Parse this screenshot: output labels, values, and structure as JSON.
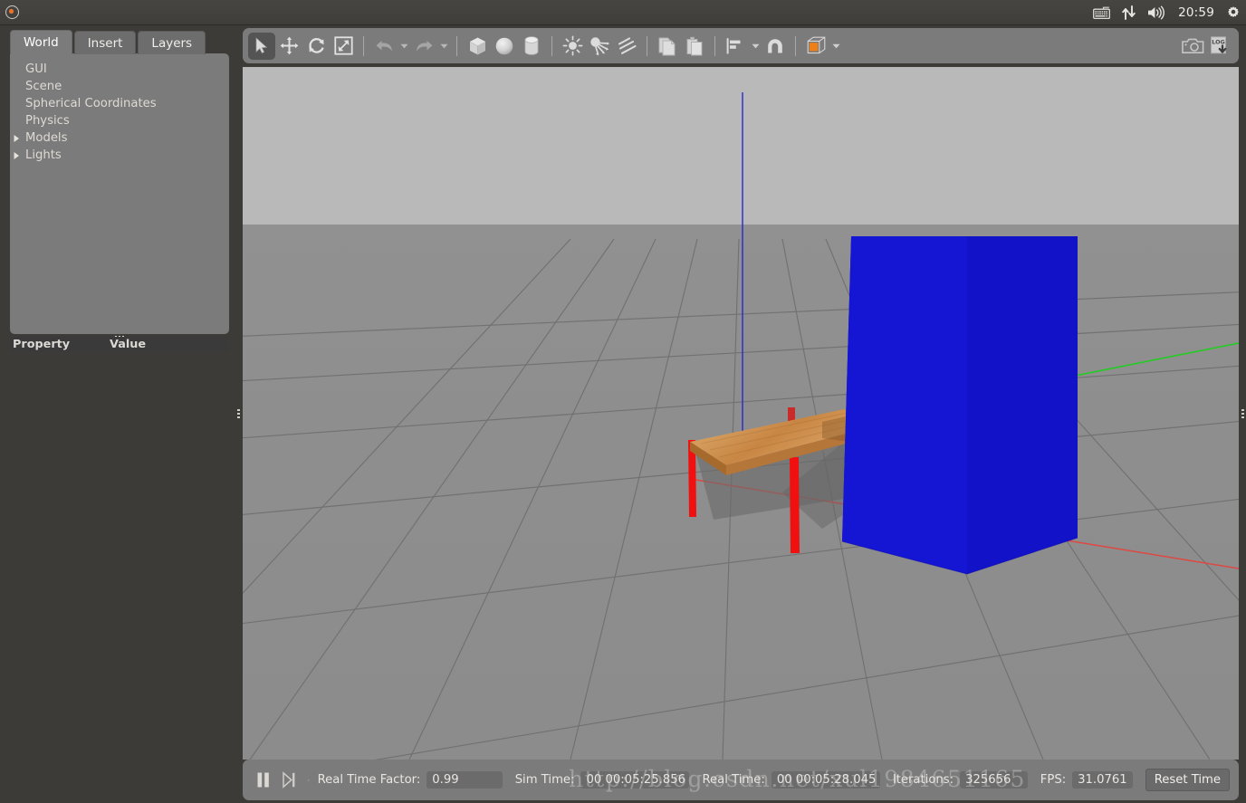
{
  "system_panel": {
    "logo_icon": "ubuntu-logo-icon",
    "tray": [
      {
        "name": "keyboard-icon",
        "label": ""
      },
      {
        "name": "network-icon",
        "label": ""
      },
      {
        "name": "volume-icon",
        "label": ""
      }
    ],
    "clock": "20:59",
    "settings_icon": "gear-icon"
  },
  "left_panel": {
    "tabs": [
      {
        "id": "world",
        "label": "World",
        "active": true
      },
      {
        "id": "insert",
        "label": "Insert",
        "active": false
      },
      {
        "id": "layers",
        "label": "Layers",
        "active": false
      }
    ],
    "tree": [
      {
        "label": "GUI",
        "expandable": false
      },
      {
        "label": "Scene",
        "expandable": false
      },
      {
        "label": "Spherical Coordinates",
        "expandable": false
      },
      {
        "label": "Physics",
        "expandable": false
      },
      {
        "label": "Models",
        "expandable": true
      },
      {
        "label": "Lights",
        "expandable": true
      }
    ],
    "property_table": {
      "headers": [
        "Property",
        "Value"
      ],
      "rows": []
    }
  },
  "toolbar": {
    "groups": [
      {
        "buttons": [
          {
            "name": "select-mode-button",
            "icon": "arrow-cursor-icon",
            "selected": true,
            "disabled": false
          },
          {
            "name": "translate-mode-button",
            "icon": "move-arrows-icon",
            "selected": false,
            "disabled": false
          },
          {
            "name": "rotate-mode-button",
            "icon": "rotate-icon",
            "selected": false,
            "disabled": false
          },
          {
            "name": "scale-mode-button",
            "icon": "scale-icon",
            "selected": false,
            "disabled": false
          }
        ]
      },
      {
        "buttons": [
          {
            "name": "undo-button",
            "icon": "undo-arrow-icon",
            "selected": false,
            "disabled": true,
            "caret": true
          },
          {
            "name": "redo-button",
            "icon": "redo-arrow-icon",
            "selected": false,
            "disabled": true,
            "caret": true
          }
        ]
      },
      {
        "buttons": [
          {
            "name": "insert-box-button",
            "icon": "box-icon",
            "selected": false,
            "disabled": false
          },
          {
            "name": "insert-sphere-button",
            "icon": "sphere-icon",
            "selected": false,
            "disabled": false
          },
          {
            "name": "insert-cylinder-button",
            "icon": "cylinder-icon",
            "selected": false,
            "disabled": false
          }
        ]
      },
      {
        "buttons": [
          {
            "name": "point-light-button",
            "icon": "point-light-icon",
            "selected": false,
            "disabled": false
          },
          {
            "name": "spot-light-button",
            "icon": "spot-light-icon",
            "selected": false,
            "disabled": false
          },
          {
            "name": "directional-light-button",
            "icon": "directional-light-icon",
            "selected": false,
            "disabled": false
          }
        ]
      },
      {
        "buttons": [
          {
            "name": "copy-button",
            "icon": "copy-icon",
            "selected": false,
            "disabled": false
          },
          {
            "name": "paste-button",
            "icon": "paste-icon",
            "selected": false,
            "disabled": false
          }
        ]
      },
      {
        "buttons": [
          {
            "name": "align-button",
            "icon": "align-icon",
            "selected": false,
            "disabled": false,
            "caret": true
          },
          {
            "name": "snap-button",
            "icon": "magnet-icon",
            "selected": false,
            "disabled": false
          }
        ]
      },
      {
        "buttons": [
          {
            "name": "view-angle-button",
            "icon": "view-cube-icon",
            "selected": false,
            "disabled": false,
            "caret": true
          }
        ]
      }
    ],
    "right_buttons": [
      {
        "name": "screenshot-button",
        "icon": "camera-icon",
        "label": ""
      },
      {
        "name": "log-record-button",
        "icon": "log-down-icon",
        "label": "LOG"
      }
    ]
  },
  "viewport": {
    "sky_color": "#b9b9b9",
    "ground_color": "#8f8f8f",
    "grid_color": "#6f6f6f",
    "axis_x_color": "#e8403a",
    "axis_y_color": "#1ecf1e",
    "axis_z_color": "#2a2ad0",
    "objects": [
      {
        "name": "table-model",
        "label": "table",
        "top_color": "#c98a49",
        "edge_color": "#a06a2e",
        "leg_color": "#f21212"
      },
      {
        "name": "blue-box-model",
        "label": "box",
        "color": "#1414d2"
      }
    ]
  },
  "stats_bar": {
    "pause_button": {
      "name": "pause-button",
      "icon": "pause-icon"
    },
    "step_button": {
      "name": "step-button",
      "icon": "step-forward-icon"
    },
    "real_time_factor_label": "Real Time Factor:",
    "real_time_factor_value": "0.99",
    "sim_time_label": "Sim Time:",
    "sim_time_value": "00 00:05:25.856",
    "real_time_label": "Real Time:",
    "real_time_value": "00 00:05:28.045",
    "iterations_label": "Iterations:",
    "iterations_value": "325656",
    "fps_label": "FPS:",
    "fps_value": "31.0761",
    "reset_time_button": "Reset Time"
  },
  "watermark": {
    "text": "http://blog.csdn.net/xul1984651165"
  }
}
